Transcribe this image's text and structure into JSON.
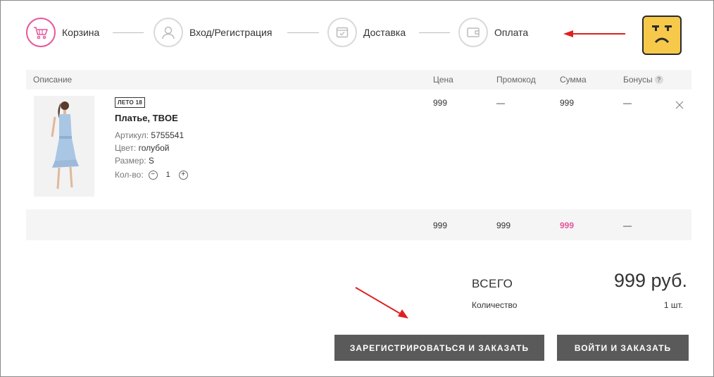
{
  "steps": [
    {
      "label": "Корзина",
      "icon": "cart-icon",
      "active": true
    },
    {
      "label": "Вход/Регистрация",
      "icon": "user-icon",
      "active": false
    },
    {
      "label": "Доставка",
      "icon": "box-icon",
      "active": false
    },
    {
      "label": "Оплата",
      "icon": "wallet-icon",
      "active": false
    }
  ],
  "accent_color": "#e6559d",
  "table": {
    "headers": {
      "description": "Описание",
      "price": "Цена",
      "promo": "Промокод",
      "sum": "Сумма",
      "bonus": "Бонусы",
      "bonus_help": "?"
    }
  },
  "item": {
    "badge": "ЛЕТО 18",
    "name": "Платье, TBOE",
    "article_label": "Артикул:",
    "article": "5755541",
    "color_label": "Цвет:",
    "color": "голубой",
    "size_label": "Размер:",
    "size": "S",
    "qty_label": "Кол-во:",
    "qty": "1",
    "minus": "−",
    "plus": "+",
    "price": "999",
    "promo": "—",
    "sum": "999",
    "bonus": "—"
  },
  "footer_row": {
    "price": "999",
    "promo": "999",
    "sum": "999",
    "bonus": "—"
  },
  "totals": {
    "total_label": "ВСЕГО",
    "total_value": "999 руб.",
    "count_label": "Количество",
    "count_value": "1 шт."
  },
  "buttons": {
    "register_order": "ЗАРЕГИСТРИРОВАТЬСЯ И ЗАКАЗАТЬ",
    "login_order": "ВОЙТИ И ЗАКАЗАТЬ"
  }
}
